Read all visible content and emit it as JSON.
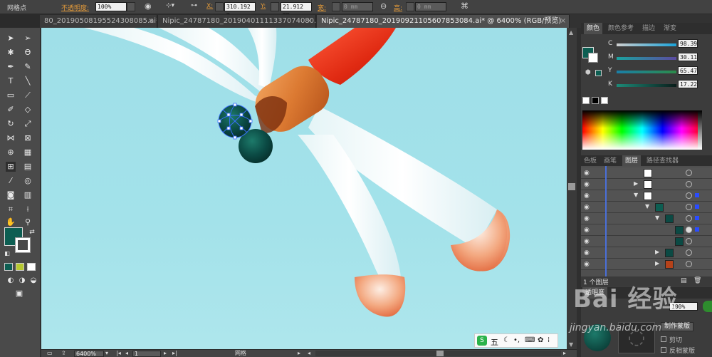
{
  "control_bar": {
    "tool_name": "网格点",
    "opacity_label": "不透明度:",
    "opacity_value": "100%",
    "x_label": "X:",
    "x_value": "310.192 m",
    "y_label": "Y:",
    "y_value": "21.912 mm",
    "width_label": "宽:",
    "width_value": "0 mm",
    "height_label": "高:",
    "height_value": "0 mm"
  },
  "tabs": [
    {
      "label": "80_20190508195524308085.ai*",
      "close": "×"
    },
    {
      "label": "Nipic_24787180_20190401111337074080.ai*",
      "close": "×"
    },
    {
      "label": "Nipic_24787180_20190921105607853084.ai* @ 6400% (RGB/预览)",
      "close": "×"
    }
  ],
  "color_panel": {
    "tabs": [
      "颜色",
      "颜色参考",
      "描边",
      "渐变"
    ],
    "channels": [
      {
        "label": "C",
        "value": "98.39"
      },
      {
        "label": "M",
        "value": "30.11"
      },
      {
        "label": "Y",
        "value": "65.47"
      },
      {
        "label": "K",
        "value": "17.22"
      }
    ],
    "fill_color": "#0d5e52"
  },
  "layers_panel": {
    "tabs": [
      "色板",
      "画笔",
      "图层",
      "路径查找器"
    ],
    "footer_text": "1 个图层"
  },
  "transparency_panel": {
    "title": "透明度",
    "opacity_value": "100%",
    "make_mask_button": "制作蒙版",
    "clip_label": "剪切",
    "invert_label": "反相蒙版"
  },
  "status_bar": {
    "zoom": "6400%",
    "page": "1",
    "tool": "网格"
  },
  "ime": {
    "label": "五"
  },
  "watermark": {
    "text": "Bai 经验",
    "sub": "jingyan.baidu.com"
  },
  "colors": {
    "canvas_bg": "#a1e0e8",
    "head_dark": "#0b4a44",
    "body_orange": "#d9772f",
    "tail_red": "#e02a12"
  }
}
